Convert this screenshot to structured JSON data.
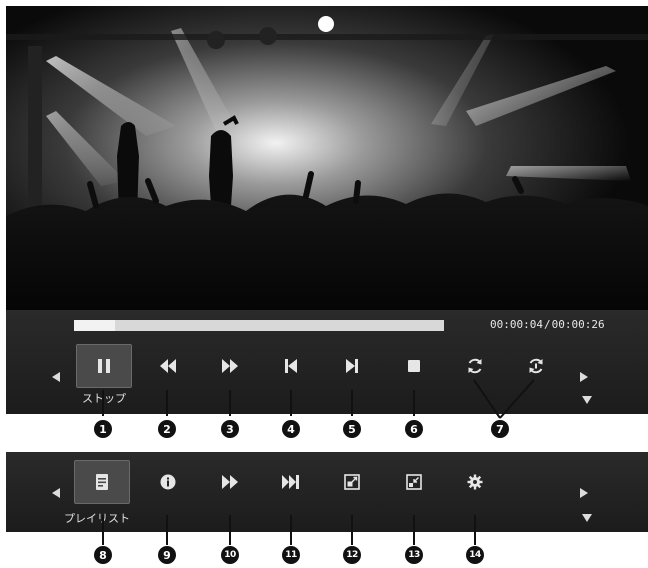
{
  "player": {
    "time_current": "00:00:04",
    "time_separator": "/",
    "time_total": "00:00:26",
    "progress_fraction": 0.11
  },
  "bar1": {
    "stop_label": "ストップ",
    "buttons": [
      {
        "icon": "pause-icon"
      },
      {
        "icon": "rewind-icon"
      },
      {
        "icon": "fast-forward-icon"
      },
      {
        "icon": "skip-previous-icon"
      },
      {
        "icon": "skip-next-icon"
      },
      {
        "icon": "stop-icon"
      },
      {
        "icon": "repeat-icon"
      },
      {
        "icon": "repeat-one-icon"
      }
    ]
  },
  "bar2": {
    "playlist_label": "プレイリスト",
    "buttons": [
      {
        "icon": "playlist-icon"
      },
      {
        "icon": "info-icon"
      },
      {
        "icon": "fast-forward-icon"
      },
      {
        "icon": "skip-next-icon"
      },
      {
        "icon": "zoom-in-icon"
      },
      {
        "icon": "zoom-out-icon"
      },
      {
        "icon": "settings-icon"
      }
    ]
  },
  "callouts": [
    "1",
    "2",
    "3",
    "4",
    "5",
    "6",
    "7",
    "8",
    "9",
    "10",
    "11",
    "12",
    "13",
    "14"
  ]
}
